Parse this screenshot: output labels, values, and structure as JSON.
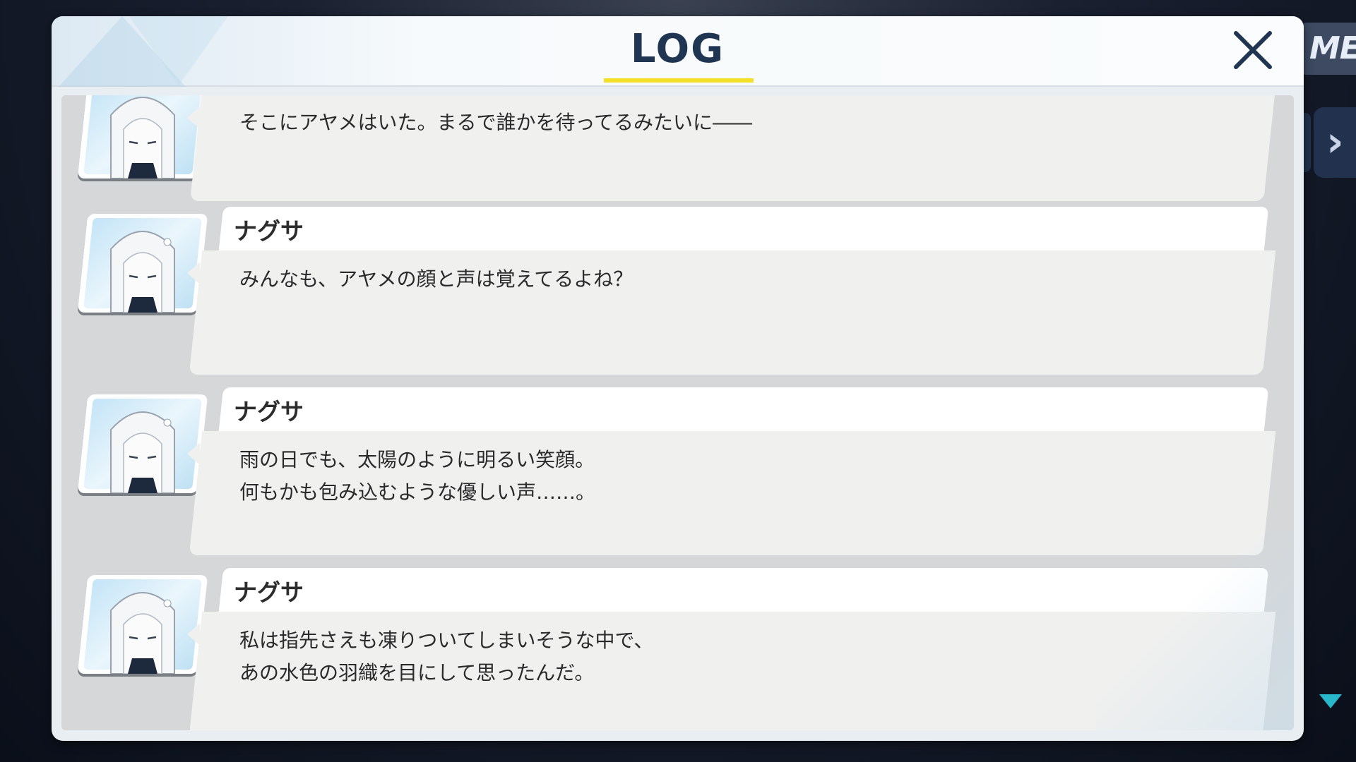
{
  "header": {
    "title": "LOG",
    "close_icon": "close-icon"
  },
  "background": {
    "menu_label": "ME"
  },
  "entries": [
    {
      "speaker": "",
      "text": "そこにアヤメはいた。まるで誰かを待ってるみたいに――"
    },
    {
      "speaker": "ナグサ",
      "text": "みんなも、アヤメの顔と声は覚えてるよね？"
    },
    {
      "speaker": "ナグサ",
      "text": "雨の日でも、太陽のように明るい笑顔。\n何もかも包み込むような優しい声……。"
    },
    {
      "speaker": "ナグサ",
      "text": "私は指先さえも凍りついてしまいそうな中で、\nあの水色の羽織を目にして思ったんだ。"
    }
  ],
  "colors": {
    "accent_underline": "#f5e028",
    "title": "#1f3552",
    "scroll_indicator": "#29b8c9"
  }
}
